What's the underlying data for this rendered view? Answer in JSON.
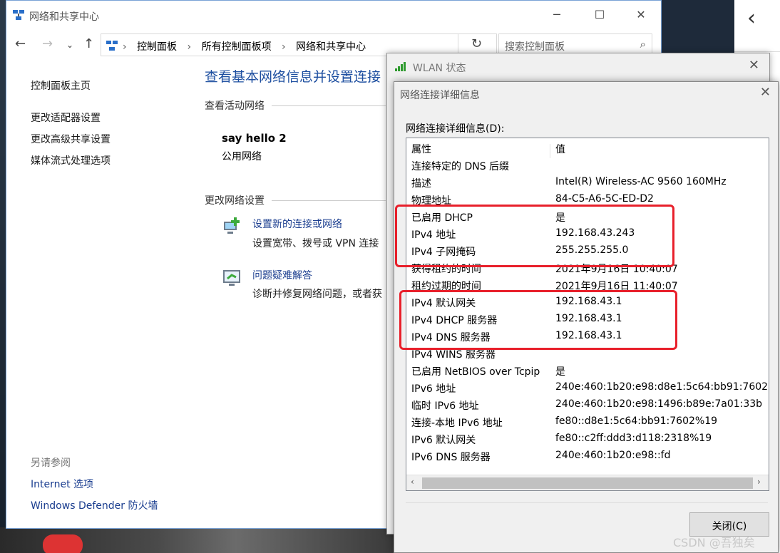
{
  "explorer": {
    "title": "网络和共享中心",
    "breadcrumbs": [
      "控制面板",
      "所有控制面板项",
      "网络和共享中心"
    ],
    "search_placeholder": "搜索控制面板",
    "sidebar": {
      "home": "控制面板主页",
      "links": [
        "更改适配器设置",
        "更改高级共享设置",
        "媒体流式处理选项"
      ],
      "see_also_heading": "另请参阅",
      "see_also": [
        "Internet 选项",
        "Windows Defender 防火墙"
      ]
    },
    "main": {
      "title": "查看基本网络信息并设置连接",
      "active_heading": "查看活动网络",
      "network_name": "say hello 2",
      "network_type": "公用网络",
      "change_heading": "更改网络设置",
      "tasks": [
        {
          "link": "设置新的连接或网络",
          "desc": "设置宽带、拨号或 VPN 连接"
        },
        {
          "link": "问题疑难解答",
          "desc": "诊断并修复网络问题，或者获"
        }
      ]
    }
  },
  "wlan": {
    "title": "WLAN 状态"
  },
  "details": {
    "title": "网络连接详细信息",
    "label": "网络连接详细信息(D):",
    "columns": [
      "属性",
      "值"
    ],
    "rows": [
      [
        "连接特定的 DNS 后缀",
        ""
      ],
      [
        "描述",
        "Intel(R) Wireless-AC 9560 160MHz"
      ],
      [
        "物理地址",
        "84-C5-A6-5C-ED-D2"
      ],
      [
        "已启用 DHCP",
        "是"
      ],
      [
        "IPv4 地址",
        "192.168.43.243"
      ],
      [
        "IPv4 子网掩码",
        "255.255.255.0"
      ],
      [
        "获得租约的时间",
        "2021年9月16日 10:40:07"
      ],
      [
        "租约过期的时间",
        "2021年9月16日 11:40:07"
      ],
      [
        "IPv4 默认网关",
        "192.168.43.1"
      ],
      [
        "IPv4 DHCP 服务器",
        "192.168.43.1"
      ],
      [
        "IPv4 DNS 服务器",
        "192.168.43.1"
      ],
      [
        "IPv4 WINS 服务器",
        ""
      ],
      [
        "已启用 NetBIOS over Tcpip",
        "是"
      ],
      [
        "IPv6 地址",
        "240e:460:1b20:e98:d8e1:5c64:bb91:7602"
      ],
      [
        "临时 IPv6 地址",
        "240e:460:1b20:e98:1496:b89e:7a01:33b"
      ],
      [
        "连接-本地 IPv6 地址",
        "fe80::d8e1:5c64:bb91:7602%19"
      ],
      [
        "IPv6 默认网关",
        "fe80::c2ff:ddd3:d118:2318%19"
      ],
      [
        "IPv6 DNS 服务器",
        "240e:460:1b20:e98::fd"
      ]
    ],
    "close_label": "关闭(C)"
  },
  "watermark": "CSDN @吾独矣",
  "colors": {
    "highlight": "#e8202b",
    "link": "#1a3d8f",
    "title_blue": "#1e4fa0"
  }
}
